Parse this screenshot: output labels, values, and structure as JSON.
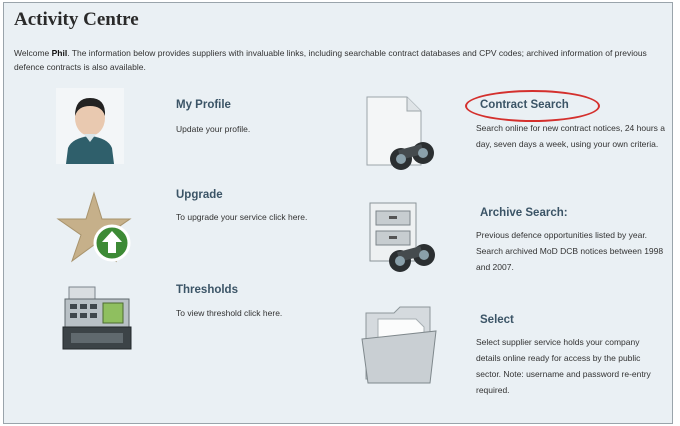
{
  "header": {
    "title": "Activity Centre"
  },
  "intro": {
    "prefix": "Welcome ",
    "user": "Phil",
    "text": ". The information below provides suppliers with invaluable links, including searchable contract databases and CPV codes; archived information of previous defence contracts is also available."
  },
  "items": {
    "profile": {
      "title": "My Profile",
      "desc": "Update your profile.",
      "icon": "user-avatar-icon"
    },
    "upgrade": {
      "title": "Upgrade",
      "desc": "To upgrade your service click here.",
      "icon": "star-upgrade-icon"
    },
    "thresholds": {
      "title": "Thresholds",
      "desc": "To view threshold click here.",
      "icon": "cash-register-icon"
    },
    "contract_search": {
      "title": "Contract Search",
      "desc": "Search online for new contract notices, 24 hours a day, seven days a week, using your own criteria.",
      "icon": "binoculars-document-icon"
    },
    "archive_search": {
      "title": "Archive Search:",
      "desc": "Previous defence opportunities listed by year. Search archived MoD DCB notices between 1998 and 2007.",
      "icon": "binoculars-archive-icon"
    },
    "select": {
      "title": "Select",
      "desc": "Select supplier service holds your company details online ready for access by the public sector. Note: username and password re-entry required.",
      "icon": "folder-icon"
    }
  },
  "colors": {
    "panel_bg": "#eaf0f4",
    "title_blue": "#3b5466",
    "highlight_red": "#d4302d"
  }
}
